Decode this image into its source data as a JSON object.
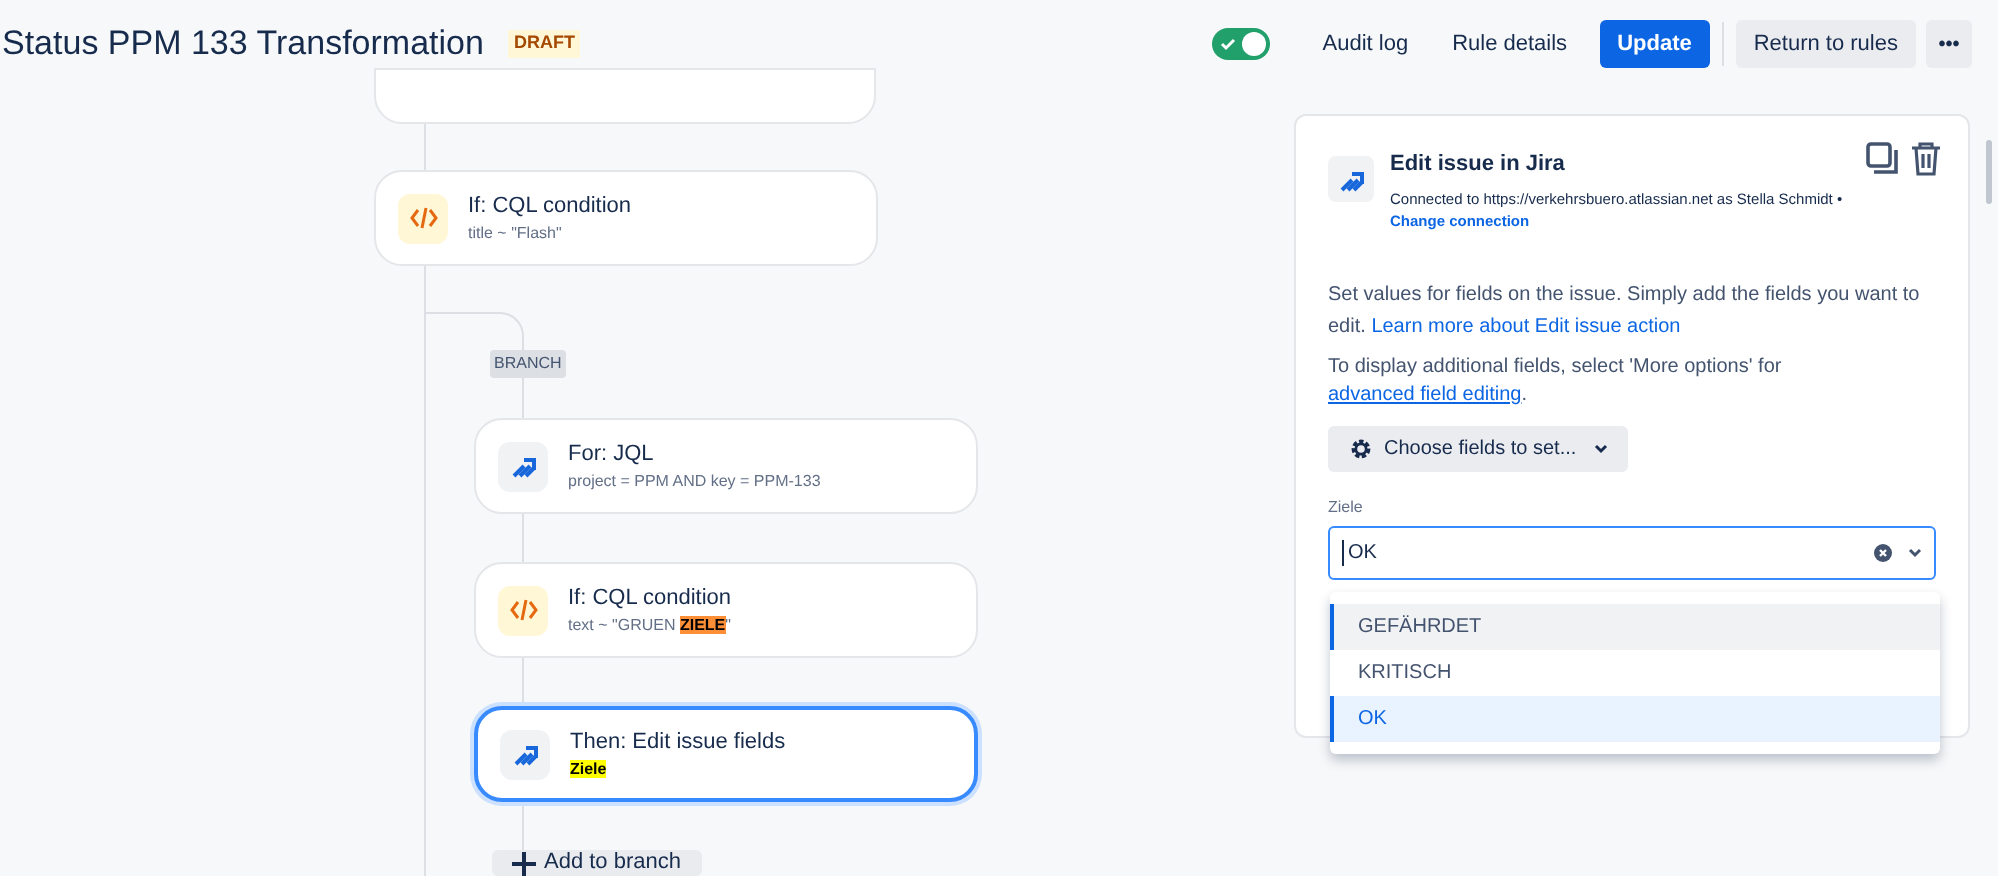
{
  "header": {
    "title": "Status PPM 133 Transformation",
    "badge": "DRAFT",
    "rule_enabled": true,
    "links": [
      "Audit log",
      "Rule details"
    ],
    "primary_button": "Update",
    "secondary_button": "Return to rules",
    "more_button": "•••"
  },
  "flow": {
    "nodes": [
      {
        "kind": "condition",
        "title": "If: CQL condition",
        "detail": [
          {
            "text": "title ~ \"Flash\""
          }
        ],
        "selected": false
      },
      {
        "kind": "branch",
        "label": "BRANCH"
      },
      {
        "kind": "jira",
        "title": "For: JQL",
        "detail": [
          {
            "text": "project = PPM AND key = PPM-133"
          }
        ],
        "selected": false
      },
      {
        "kind": "condition",
        "title": "If: CQL condition",
        "detail": [
          {
            "text": "text ~ \"GRUEN "
          },
          {
            "text": "ZIELE",
            "color": "#ff8f36"
          },
          {
            "text": "\""
          }
        ],
        "selected": false
      },
      {
        "kind": "jira",
        "title": "Then: Edit issue fields",
        "detail": [
          {
            "text": "Ziele",
            "color": "#ffff00"
          }
        ],
        "selected": true
      }
    ],
    "add_button": "Add to branch"
  },
  "panel": {
    "title": "Edit issue in Jira",
    "connection": "Connected to https://verkehrsbuero.atlassian.net as Stella Schmidt •",
    "change_link": "Change connection",
    "description": "Set values for fields on the issue. Simply add the fields you want to edit. ",
    "learn_link": "Learn more about Edit issue action",
    "advanced_text": "To display additional fields, select 'More options' for ",
    "advanced_link": "advanced field editing",
    "advanced_end": ".",
    "choose_button": "Choose fields to set...",
    "field": {
      "label": "Ziele",
      "value": "OK",
      "options": [
        {
          "label": "GEFÄHRDET",
          "selected": false,
          "focused": true
        },
        {
          "label": "KRITISCH",
          "selected": false,
          "focused": false
        },
        {
          "label": "OK",
          "selected": true,
          "focused": true
        }
      ]
    }
  }
}
